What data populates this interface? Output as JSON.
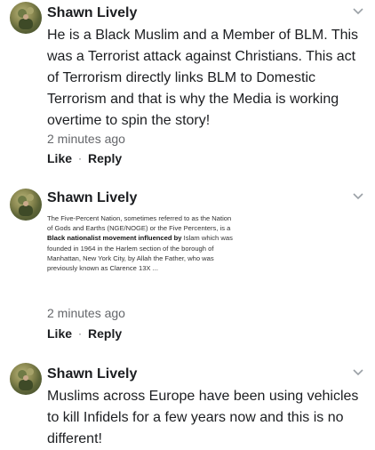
{
  "comments": [
    {
      "author": "Shawn Lively",
      "text": "He is a Black Muslim and a Member of BLM. This was a Terrorist attack against Christians. This act of Terrorism directly links BLM to Domestic Terrorism and that is why the Media is working overtime to spin the story!",
      "time": "2 minutes ago",
      "like_label": "Like",
      "reply_label": "Reply"
    },
    {
      "author": "Shawn Lively",
      "screenshot_text": {
        "part1": "The Five-Percent Nation, sometimes referred to as the Nation of Gods and Earths (NGE/NOGE) or the Five Percenters, is a ",
        "bold": "Black nationalist movement influenced by",
        "part2": " Islam which was founded in 1964 in the Harlem section of the borough of Manhattan, New York City, by Allah the Father, who was previously known as Clarence 13X ..."
      },
      "time": "2 minutes ago",
      "like_label": "Like",
      "reply_label": "Reply"
    },
    {
      "author": "Shawn Lively",
      "text": "Muslims across Europe have been using vehicles to kill Infidels for a few years now and this is no different!"
    }
  ],
  "separator": "·",
  "icons": {
    "menu": "chevron-down-icon",
    "avatar": "avatar"
  }
}
